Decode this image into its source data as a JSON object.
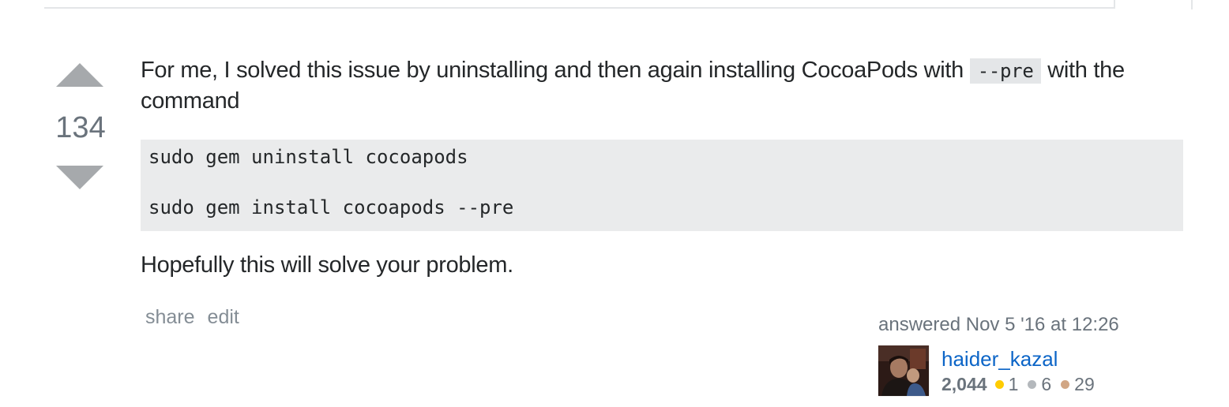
{
  "post": {
    "vote_count": "134",
    "text_before_code": "For me, I solved this issue by uninstalling and then again installing CocoaPods with ",
    "inline_code": "--pre",
    "text_after_code": " with the command",
    "code_lines": [
      "sudo gem uninstall cocoapods",
      "sudo gem install cocoapods --pre"
    ],
    "closing_text": "Hopefully this will solve your problem."
  },
  "menu": {
    "share_label": "share",
    "edit_label": "edit"
  },
  "user": {
    "action_time": "answered Nov 5 '16 at 12:26",
    "name": "haider_kazal",
    "reputation": "2,044",
    "badges": {
      "gold_count": "1",
      "silver_count": "6",
      "bronze_count": "29"
    }
  },
  "colors": {
    "gold": "#ffcc01",
    "silver": "#b4b8bc",
    "bronze": "#d1a684",
    "link": "#0c65c7",
    "vote_arrow": "#a6a9ac"
  },
  "icons": {
    "vote_up": "upvote-arrow-icon",
    "vote_down": "downvote-arrow-icon"
  }
}
